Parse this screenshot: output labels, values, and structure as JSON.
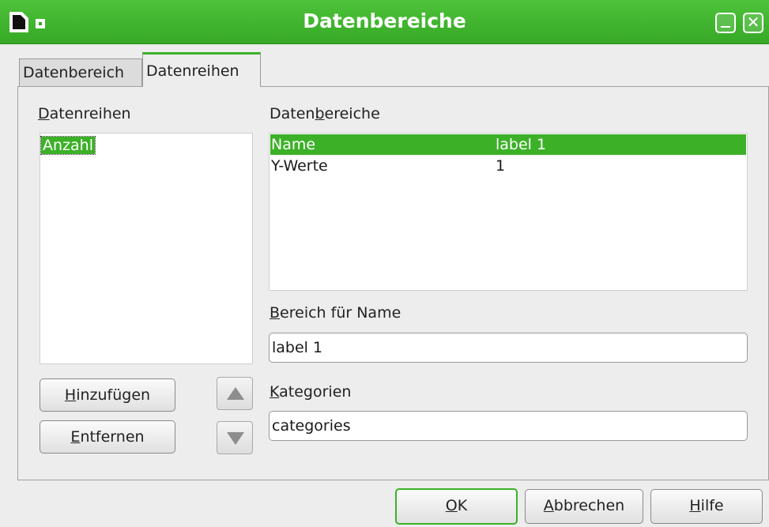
{
  "window": {
    "title": "Datenbereiche"
  },
  "tabs": [
    {
      "label": "Datenbereich",
      "active": false
    },
    {
      "label": "Datenreihen",
      "active": true
    }
  ],
  "series_panel": {
    "label": "Datenreihen",
    "items": [
      "Anzahl"
    ],
    "selected": "Anzahl",
    "add_button": "Hinzufügen",
    "remove_button": "Entfernen"
  },
  "ranges_panel": {
    "label": "Datenbereiche",
    "rows": [
      {
        "role": "Name",
        "range": "label 1"
      },
      {
        "role": "Y-Werte",
        "range": "1"
      }
    ]
  },
  "name_range": {
    "label": "Bereich für Name",
    "value": "label 1"
  },
  "categories": {
    "label": "Kategorien",
    "value": "categories"
  },
  "footer": {
    "ok": "OK",
    "cancel": "Abbrechen",
    "help": "Hilfe"
  },
  "colors": {
    "accent": "#3cb128",
    "titlebar": "#36a826"
  }
}
